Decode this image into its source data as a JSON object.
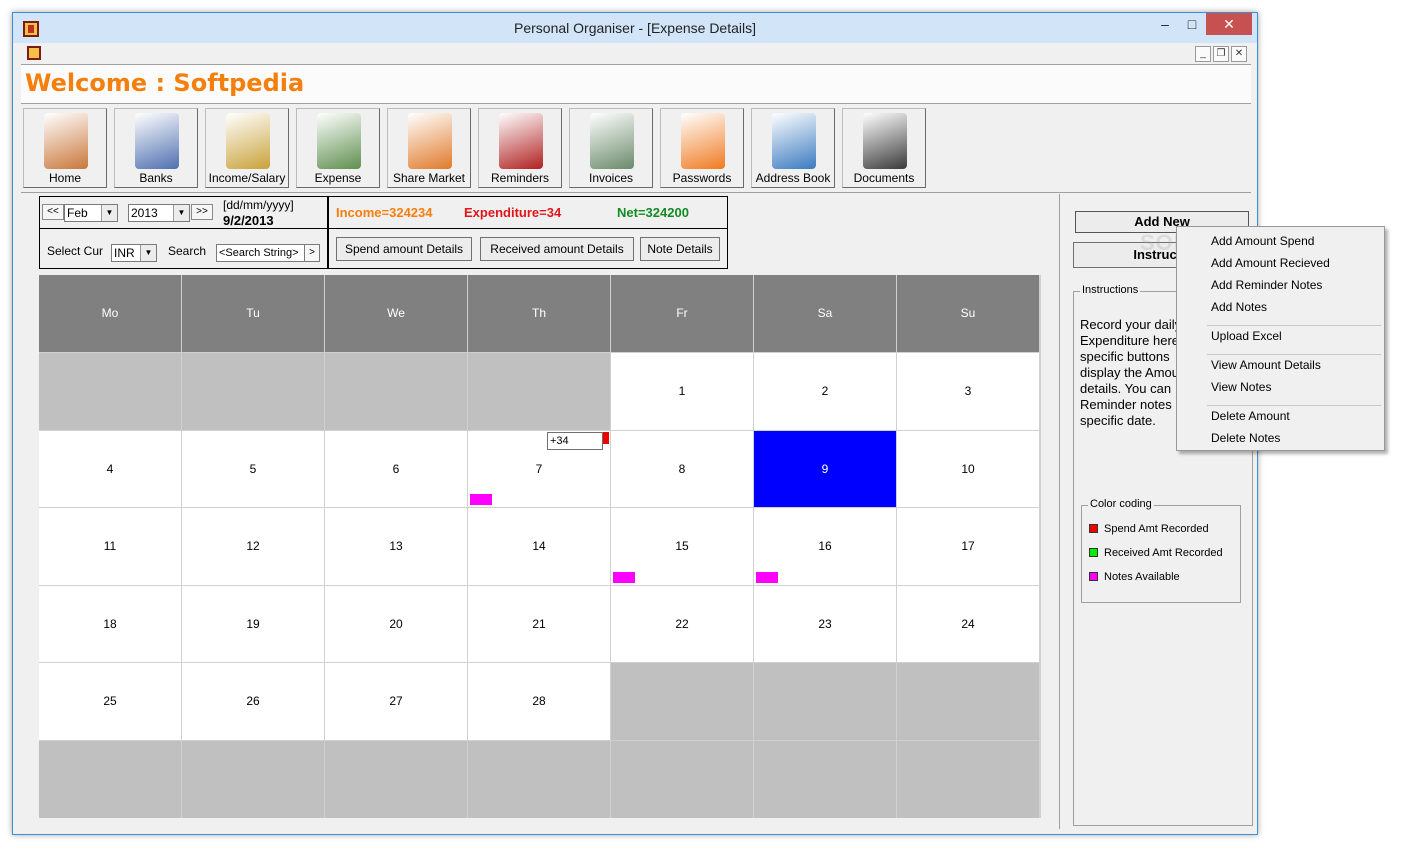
{
  "window": {
    "title": "Personal Organiser - [Expense Details]",
    "minimize": "–",
    "maximize": "□",
    "close": "✕",
    "mdi_min": "_",
    "mdi_restore": "❐",
    "mdi_close": "✕"
  },
  "welcome": "Welcome : Softpedia",
  "toolbar": [
    {
      "label": "Home",
      "icon": "house-icon",
      "color": "#c9773a"
    },
    {
      "label": "Banks",
      "icon": "bank-icon",
      "color": "#4f6fb0"
    },
    {
      "label": "Income/Salary",
      "icon": "wallet-icon",
      "color": "#c9a23a"
    },
    {
      "label": "Expense",
      "icon": "magnifier-money-icon",
      "color": "#5e8f4e"
    },
    {
      "label": "Share Market",
      "icon": "chart-arrow-icon",
      "color": "#e07a2a"
    },
    {
      "label": "Reminders",
      "icon": "clock-calendar-icon",
      "color": "#b02020"
    },
    {
      "label": "Invoices",
      "icon": "invoice-icon",
      "color": "#6a8a6a"
    },
    {
      "label": "Passwords",
      "icon": "lock-icon",
      "color": "#f07a20"
    },
    {
      "label": "Address Book",
      "icon": "address-book-icon",
      "color": "#3a7ac0"
    },
    {
      "label": "Documents",
      "icon": "briefcase-documents-icon",
      "color": "#3a3a3a"
    }
  ],
  "nav": {
    "prev": "<<",
    "next": ">>",
    "month": "Feb",
    "year": "2013",
    "date_format": "[dd/mm/yyyy]",
    "date": "9/2/2013"
  },
  "filters": {
    "select_cur_label": "Select Cur",
    "currency": "INR",
    "search_label": "Search",
    "search_value": "<Search String>",
    "search_go": ">"
  },
  "summary": {
    "income": "Income=324234",
    "expenditure": "Expenditure=34",
    "net": "Net=324200"
  },
  "buttons": {
    "spend_details": "Spend amount Details",
    "received_details": "Received amount Details",
    "note_details": "Note Details"
  },
  "calendar": {
    "headers": [
      "Mo",
      "Tu",
      "We",
      "Th",
      "Fr",
      "Sa",
      "Su"
    ],
    "weeks": [
      [
        "",
        "",
        "",
        "",
        "1",
        "2",
        "3"
      ],
      [
        "4",
        "5",
        "6",
        "7",
        "8",
        "9",
        "10"
      ],
      [
        "11",
        "12",
        "13",
        "14",
        "15",
        "16",
        "17"
      ],
      [
        "18",
        "19",
        "20",
        "21",
        "22",
        "23",
        "24"
      ],
      [
        "25",
        "26",
        "27",
        "28",
        "",
        "",
        ""
      ],
      [
        "",
        "",
        "",
        "",
        "",
        "",
        ""
      ]
    ],
    "selected_day": "9",
    "notes_days": [
      "7",
      "15",
      "16"
    ],
    "amount_tag": "+34"
  },
  "side": {
    "add_new": "Add New",
    "instructions_btn": "Instructio",
    "instructions_legend": "Instructions",
    "instructions_text": "Record your daily\nExpenditure here\nspecific buttons\ndisplay the Amou\ndetails. You can\nReminder notes\nspecific date.",
    "color_legend": "Color coding",
    "color_items": [
      {
        "label": "Spend Amt Recorded",
        "color": "#ee0000"
      },
      {
        "label": "Received Amt Recorded",
        "color": "#00ee00"
      },
      {
        "label": "Notes Available",
        "color": "#ff00ff"
      }
    ]
  },
  "context_menu": {
    "groups": [
      [
        "Add Amount Spend",
        "Add Amount Recieved",
        "Add Reminder Notes",
        "Add Notes"
      ],
      [
        "Upload Excel"
      ],
      [
        "View Amount Details",
        "View Notes"
      ],
      [
        "Delete Amount",
        "Delete Notes"
      ]
    ]
  },
  "colors": {
    "accent_orange": "#f47f0c",
    "selected_blue": "#0000ff",
    "header_gray": "#808080",
    "empty_gray": "#c0c0c0",
    "note_magenta": "#ff00ff"
  }
}
